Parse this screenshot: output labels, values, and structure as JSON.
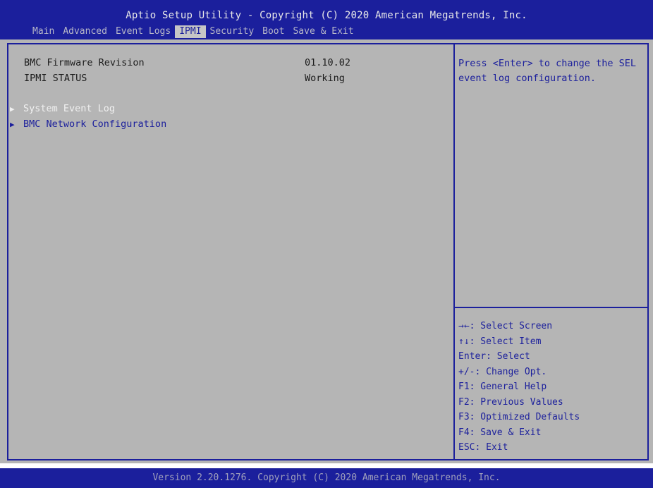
{
  "header": {
    "title": "Aptio Setup Utility - Copyright (C) 2020 American Megatrends, Inc.",
    "tabs": [
      {
        "label": "Main",
        "active": false
      },
      {
        "label": "Advanced",
        "active": false
      },
      {
        "label": "Event Logs",
        "active": false
      },
      {
        "label": "IPMI",
        "active": true
      },
      {
        "label": "Security",
        "active": false
      },
      {
        "label": "Boot",
        "active": false
      },
      {
        "label": "Save & Exit",
        "active": false
      }
    ]
  },
  "main": {
    "info": [
      {
        "label": "BMC Firmware Revision",
        "value": "01.10.02"
      },
      {
        "label": "IPMI STATUS",
        "value": "Working"
      }
    ],
    "submenus": [
      {
        "label": "System Event Log",
        "arrow": "▶"
      },
      {
        "label": "BMC Network Configuration",
        "arrow": "▶"
      }
    ]
  },
  "help": {
    "text": "Press <Enter> to change the SEL event log configuration.",
    "keys": [
      "→←: Select Screen",
      "↑↓: Select Item",
      "Enter: Select",
      "+/-: Change Opt.",
      "F1: General Help",
      "F2: Previous Values",
      "F3: Optimized Defaults",
      "F4: Save & Exit",
      "ESC: Exit"
    ]
  },
  "footer": {
    "text": "Version 2.20.1276. Copyright (C) 2020 American Megatrends, Inc."
  },
  "colors": {
    "bios_blue": "#1b1f9c",
    "panel_gray": "#b5b5b5",
    "selected_text": "#f0f0f0"
  }
}
